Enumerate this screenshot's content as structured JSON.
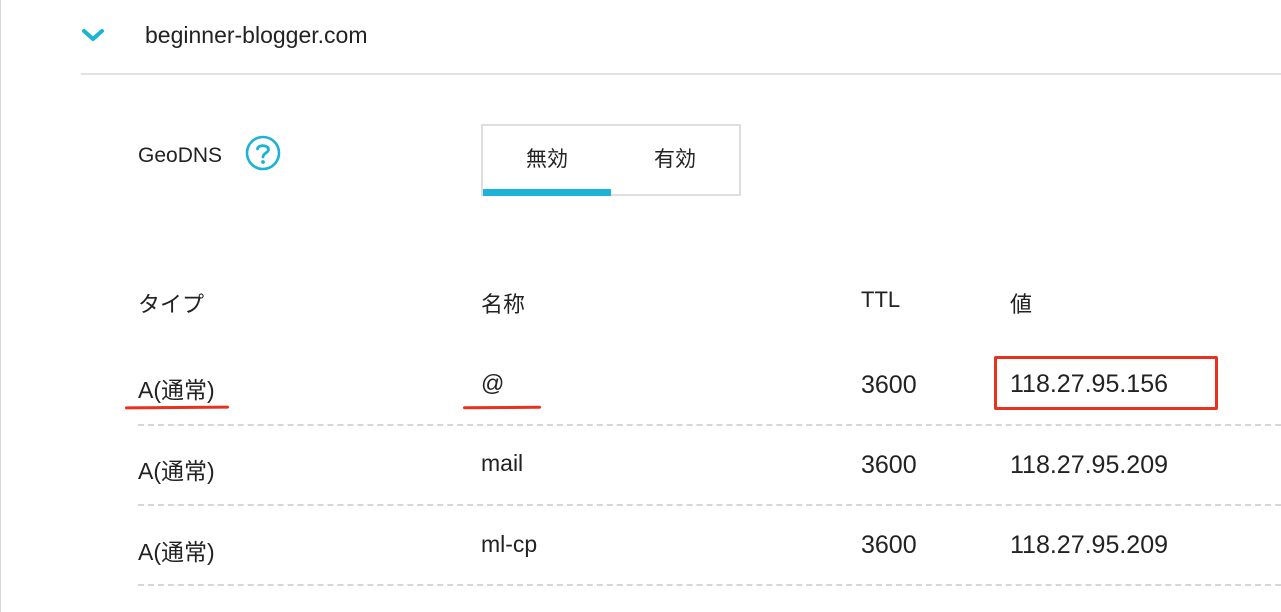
{
  "domain": {
    "name": "beginner-blogger.com",
    "expand_icon": "chevron-down-icon"
  },
  "geodns": {
    "label": "GeoDNS",
    "help_icon": "question-circle-icon",
    "options": [
      "無効",
      "有効"
    ],
    "selected": "無効"
  },
  "table": {
    "headers": {
      "type": "タイプ",
      "name": "名称",
      "ttl": "TTL",
      "value": "値"
    },
    "rows": [
      {
        "type": "A(通常)",
        "name": "@",
        "ttl": "3600",
        "value": "118.27.95.156"
      },
      {
        "type": "A(通常)",
        "name": "mail",
        "ttl": "3600",
        "value": "118.27.95.209"
      },
      {
        "type": "A(通常)",
        "name": "ml-cp",
        "ttl": "3600",
        "value": "118.27.95.209"
      }
    ]
  },
  "colors": {
    "accent": "#1bb3d6",
    "annotation": "#e8321e",
    "divider": "#d6d6d6"
  }
}
